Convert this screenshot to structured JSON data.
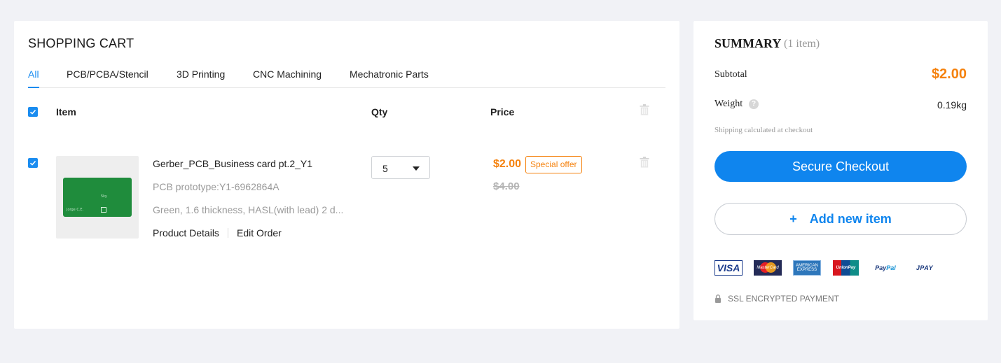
{
  "cart": {
    "title": "SHOPPING CART",
    "tabs": [
      "All",
      "PCB/PCBA/Stencil",
      "3D Printing",
      "CNC Machining",
      "Mechatronic Parts"
    ],
    "active_tab": "All",
    "columns": {
      "item": "Item",
      "qty": "Qty",
      "price": "Price"
    },
    "items": [
      {
        "checked": true,
        "thumbnail_text": [
          "5ky",
          "Jorge C.E."
        ],
        "name": "Gerber_PCB_Business card pt.2_Y1",
        "prototype": "PCB prototype:Y1-6962864A",
        "specs": "Green, 1.6 thickness, HASL(with lead) 2 d...",
        "links": {
          "details": "Product Details",
          "edit": "Edit Order"
        },
        "qty": "5",
        "price": "$2.00",
        "offer_label": "Special offer",
        "original_price": "$4.00"
      }
    ]
  },
  "summary": {
    "title": "SUMMARY",
    "item_count": "(1 item)",
    "subtotal_label": "Subtotal",
    "subtotal": "$2.00",
    "weight_label": "Weight",
    "weight": "0.19kg",
    "shipping_note": "Shipping calculated at checkout",
    "checkout_label": "Secure Checkout",
    "add_item_label": "Add new item",
    "payment_methods": {
      "visa": "VISA",
      "mastercard": "MasterCard",
      "amex_line1": "AMERICAN",
      "amex_line2": "EXPRESS",
      "unionpay": "UnionPay",
      "paypal_1": "Pay",
      "paypal_2": "Pal",
      "jpay": "JPAY"
    },
    "ssl_label": "SSL ENCRYPTED PAYMENT"
  },
  "colors": {
    "accent": "#0f85ee",
    "price": "#f5820e",
    "background": "#f1f2f6",
    "pcb": "#1f8c3c"
  },
  "icons": [
    "check-icon",
    "trash-icon",
    "chevron-down-icon",
    "help-icon",
    "plus-icon",
    "lock-icon"
  ]
}
